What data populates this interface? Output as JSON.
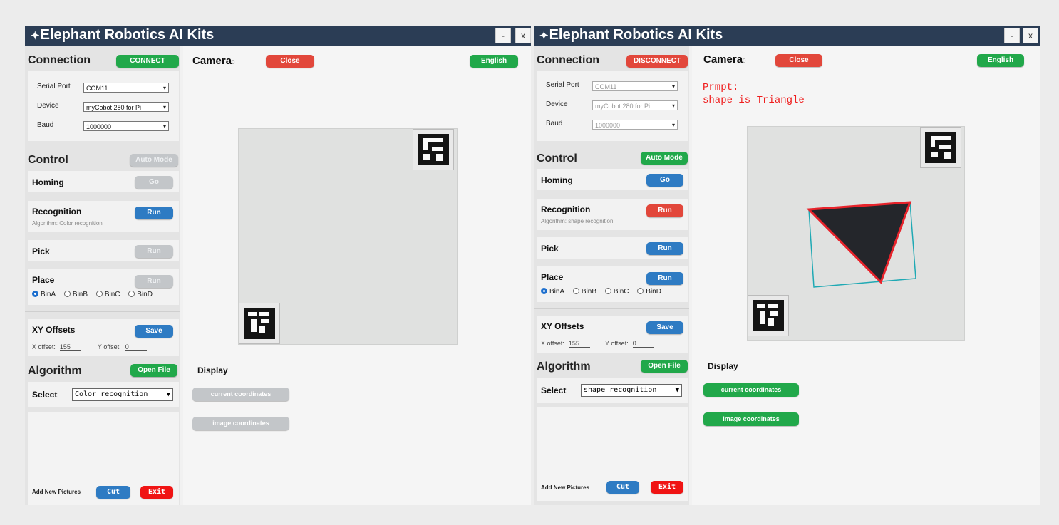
{
  "windows": [
    {
      "title": "Elephant Robotics AI Kits",
      "logo": "✦",
      "min_label": "-",
      "close_label": "x",
      "connection": {
        "title": "Connection",
        "button": "CONNECT",
        "button_color": "#21a84a",
        "serial_port_label": "Serial Port",
        "serial_port_value": "COM11",
        "device_label": "Device",
        "device_value": "myCobot 280 for Pi",
        "baud_label": "Baud",
        "baud_value": "1000000"
      },
      "control": {
        "title": "Control",
        "mode_button": "Auto Mode",
        "homing_label": "Homing",
        "homing_button": "Go",
        "recognition_label": "Recognition",
        "recognition_button": "Run",
        "algorithm_text": "Algorithm: Color recognition",
        "pick_label": "Pick",
        "pick_button": "Run",
        "place_label": "Place",
        "place_button": "Run",
        "bins": [
          "BinA",
          "BinB",
          "BinC",
          "BinD"
        ],
        "selected_bin": "BinA"
      },
      "offsets": {
        "title": "XY Offsets",
        "save_button": "Save",
        "x_label": "X offset:",
        "x_value": "155",
        "y_label": "Y offset:",
        "y_value": "0"
      },
      "algorithm": {
        "title": "Algorithm",
        "open_button": "Open File",
        "select_label": "Select",
        "select_value": "Color recognition"
      },
      "pictures": {
        "label": "Add New Pictures",
        "cut_button": "Cut",
        "exit_button": "Exit"
      },
      "camera": {
        "title": "Camera",
        "counter": "0",
        "close_button": "Close",
        "language_button": "English",
        "prompt": "",
        "display_label": "Display",
        "current_coords_button": "current coordinates",
        "image_coords_button": "image coordinates"
      }
    },
    {
      "title": "Elephant Robotics AI Kits",
      "logo": "✦",
      "min_label": "-",
      "close_label": "x",
      "connection": {
        "title": "Connection",
        "button": "DISCONNECT",
        "button_color": "#e2473b",
        "serial_port_label": "Serial Port",
        "serial_port_value": "COM11",
        "device_label": "Device",
        "device_value": "myCobot 280 for Pi",
        "baud_label": "Baud",
        "baud_value": "1000000"
      },
      "control": {
        "title": "Control",
        "mode_button": "Auto Mode",
        "homing_label": "Homing",
        "homing_button": "Go",
        "recognition_label": "Recognition",
        "recognition_button": "Run",
        "algorithm_text": "Algorithm: shape recognition",
        "pick_label": "Pick",
        "pick_button": "Run",
        "place_label": "Place",
        "place_button": "Run",
        "bins": [
          "BinA",
          "BinB",
          "BinC",
          "BinD"
        ],
        "selected_bin": "BinA"
      },
      "offsets": {
        "title": "XY Offsets",
        "save_button": "Save",
        "x_label": "X offset:",
        "x_value": "155",
        "y_label": "Y offset:",
        "y_value": "0"
      },
      "algorithm": {
        "title": "Algorithm",
        "open_button": "Open File",
        "select_label": "Select",
        "select_value": "shape recognition"
      },
      "pictures": {
        "label": "Add New Pictures",
        "cut_button": "Cut",
        "exit_button": "Exit"
      },
      "camera": {
        "title": "Camera",
        "counter": "0",
        "close_button": "Close",
        "language_button": "English",
        "prompt": "Prmpt:\nshape is Triangle",
        "display_label": "Display",
        "current_coords_button": "current coordinates",
        "image_coords_button": "image coordinates"
      }
    }
  ],
  "colors": {
    "titlebar": "#2b3d55",
    "green": "#21a84a",
    "red": "#e2473b",
    "blue": "#2e7bc3",
    "disabled": "#c3c6c9",
    "prompt_red": "#ef1c1c",
    "detect_red": "#e8232b",
    "detect_cyan": "#1fa9b4"
  }
}
